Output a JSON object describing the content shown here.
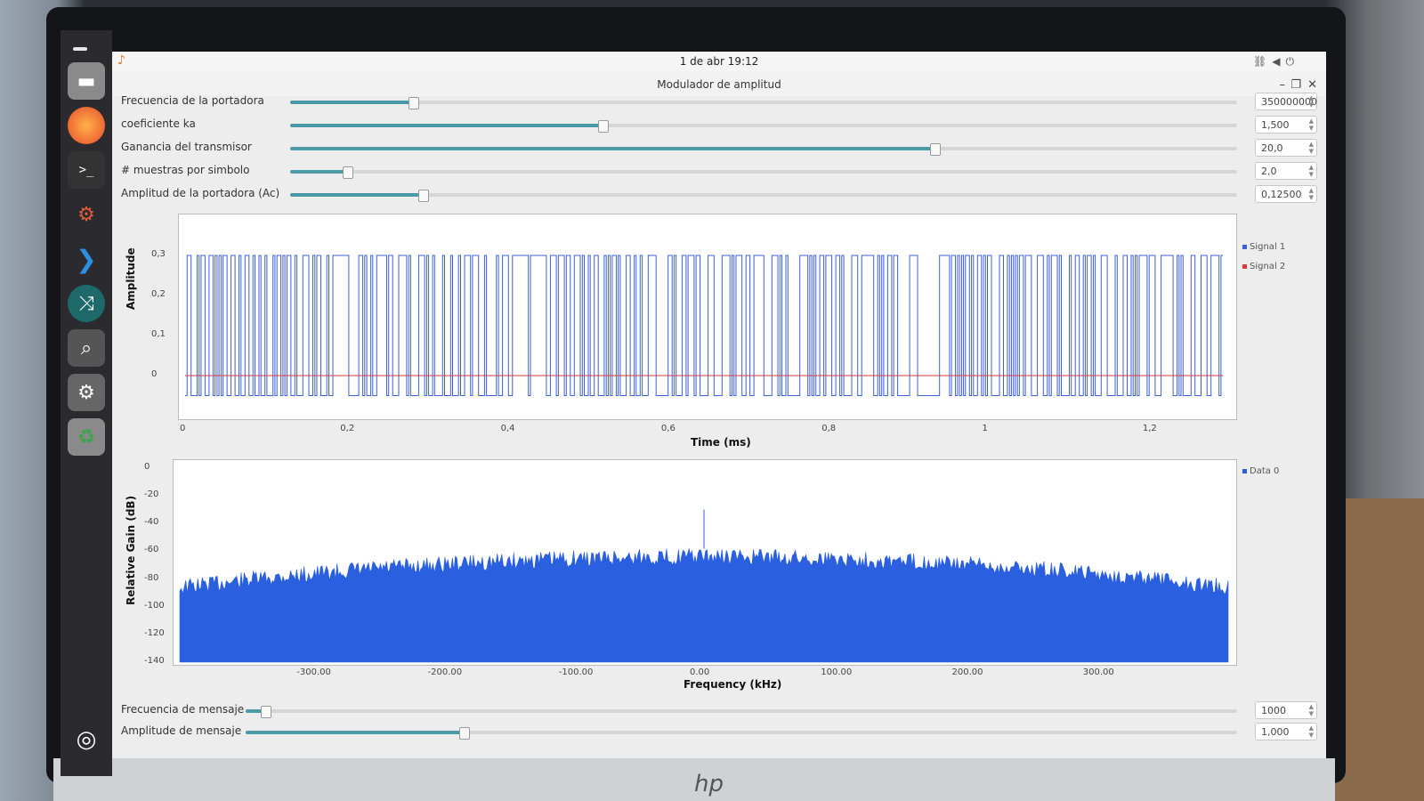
{
  "system": {
    "clock": "1 de abr  19:12",
    "tray_icons": [
      "network-icon",
      "volume-icon",
      "power-icon"
    ]
  },
  "dock": {
    "items": [
      "files-icon",
      "firefox-icon",
      "terminal-icon",
      "gnuradio-icon",
      "vscode-icon",
      "app-icon",
      "search-icon",
      "settings-icon",
      "trash-icon",
      "ubuntu-logo-icon"
    ]
  },
  "window": {
    "title": "Modulador de amplitud",
    "minimize": "–",
    "maximize": "❐",
    "close": "✕"
  },
  "controls": [
    {
      "label": "Frecuencia de la portadora",
      "value": "350000000",
      "level": 0.13
    },
    {
      "label": "coeficiente ka",
      "value": "1,500",
      "level": 0.33
    },
    {
      "label": "Ganancia del transmisor",
      "value": "20,0",
      "level": 0.68
    },
    {
      "label": "# muestras por simbolo",
      "value": "2,0",
      "level": 0.06
    },
    {
      "label": "Amplitud de la portadora (Ac)",
      "value": "0,12500",
      "level": 0.14
    }
  ],
  "bottom_controls": [
    {
      "label": "Frecuencia de mensaje",
      "value": "1000",
      "level": 0.02
    },
    {
      "label": "Amplitude de mensaje",
      "value": "1,000",
      "level": 0.22
    }
  ],
  "colors": {
    "slider_fill": "#4a9aa8",
    "signal1": "#3d5fd6",
    "signal2": "#d23b3b",
    "data0": "#2a5fe0"
  },
  "chart_data": [
    {
      "type": "line",
      "xlabel": "Time (ms)",
      "ylabel": "Amplitude",
      "xlim": [
        0,
        1.3
      ],
      "ylim": [
        -0.08,
        0.36
      ],
      "x_ticks": [
        "0",
        "0,2",
        "0,4",
        "0,6",
        "0,8",
        "1",
        "1,2"
      ],
      "y_ticks": [
        "0,3",
        "0,2",
        "0,1",
        "0"
      ],
      "legend_position": "right",
      "series": [
        {
          "name": "Signal 1",
          "color": "#3d5fd6",
          "description_levels": [
            -0.05,
            0.3
          ]
        },
        {
          "name": "Signal 2",
          "color": "#d23b3b",
          "values_constant": 0
        }
      ]
    },
    {
      "type": "area",
      "xlabel": "Frequency (kHz)",
      "ylabel": "Relative Gain (dB)",
      "xlim": [
        -400,
        400
      ],
      "ylim": [
        -140,
        0
      ],
      "x_ticks": [
        "-300.00",
        "-200.00",
        "-100.00",
        "0.00",
        "100.00",
        "200.00",
        "300.00"
      ],
      "y_ticks": [
        "0",
        "-20",
        "-40",
        "-60",
        "-80",
        "-100",
        "-120",
        "-140"
      ],
      "legend_position": "right",
      "series": [
        {
          "name": "Data 0",
          "color": "#2a5fe0",
          "edge_level_db": -80,
          "center_level_db": -58,
          "peak_db": -30
        }
      ]
    }
  ]
}
